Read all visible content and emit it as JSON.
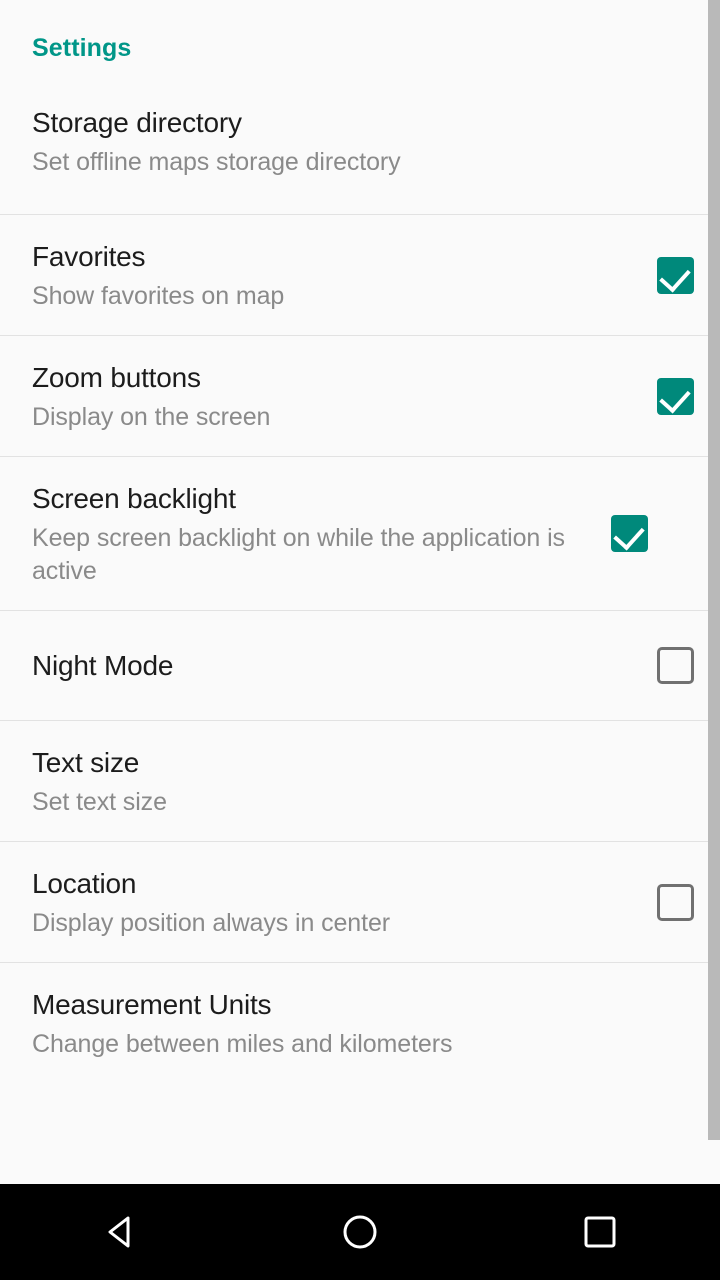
{
  "screen": {
    "app_section_title": "Settings",
    "background_color": "#fafafa",
    "accent_color": "#009688",
    "checkbox_checked_color": "#00897b",
    "checkbox_unchecked_color": "#707070",
    "divider_color": "#e2e2e2",
    "title_text_color": "#1c1c1c",
    "summary_text_color": "#8a8a8a"
  },
  "preferences": [
    {
      "key": "storage_directory",
      "title": "Storage directory",
      "summary": "Set offline maps storage directory",
      "control": "none",
      "checked": null
    },
    {
      "key": "favorites",
      "title": "Favorites",
      "summary": "Show favorites on map",
      "control": "checkbox",
      "checked": true
    },
    {
      "key": "zoom_buttons",
      "title": "Zoom buttons",
      "summary": "Display on the screen",
      "control": "checkbox",
      "checked": true
    },
    {
      "key": "screen_backlight",
      "title": "Screen backlight",
      "summary": "Keep screen backlight on while the application is active",
      "control": "checkbox",
      "checked": true
    },
    {
      "key": "night_mode",
      "title": "Night Mode",
      "summary": "",
      "control": "checkbox",
      "checked": false
    },
    {
      "key": "text_size",
      "title": "Text size",
      "summary": "Set text size",
      "control": "none",
      "checked": null
    },
    {
      "key": "location",
      "title": "Location",
      "summary": "Display position always in center",
      "control": "checkbox",
      "checked": false
    },
    {
      "key": "measurement_units",
      "title": "Measurement Units",
      "summary": "Change between miles and kilometers",
      "control": "none",
      "checked": null
    }
  ],
  "scrollbar": {
    "visible": true,
    "color": "#b9b9b9"
  },
  "navigation_bar": {
    "background_color": "#000000",
    "buttons": [
      {
        "key": "back",
        "icon": "back-triangle-icon",
        "label": "Back"
      },
      {
        "key": "home",
        "icon": "home-circle-icon",
        "label": "Home"
      },
      {
        "key": "recents",
        "icon": "recents-square-icon",
        "label": "Recent apps"
      }
    ]
  }
}
